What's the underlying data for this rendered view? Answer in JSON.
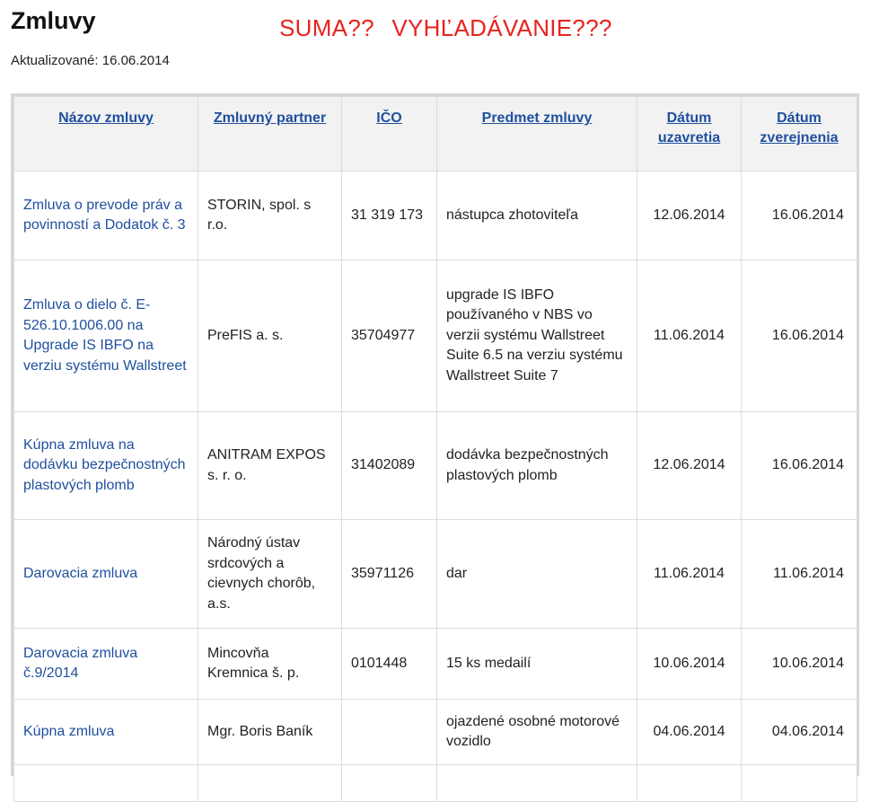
{
  "page": {
    "title": "Zmluvy",
    "annotation": "SUMA??   VYHĽADÁVANIE???",
    "updated": "Aktualizované: 16.06.2014"
  },
  "table": {
    "headers": [
      "Názov zmluvy",
      "Zmluvný partner",
      "IČO",
      "Predmet zmluvy",
      "Dátum uzavretia",
      "Dátum zverejnenia"
    ],
    "rows": [
      {
        "name": "Zmluva o prevode práv a povinností a Dodatok č. 3",
        "partner": "STORIN, spol. s r.o.",
        "ico": "31 319 173",
        "subject": "nástupca zhotoviteľa",
        "concluded": "12.06.2014",
        "published": "16.06.2014"
      },
      {
        "name": "Zmluva o dielo č. E-526.10.1006.00 na Upgrade IS IBFO na verziu systému Wallstreet",
        "partner": "PreFIS a. s.",
        "ico": "35704977",
        "subject": "upgrade IS IBFO používaného v NBS vo verzii systému Wallstreet Suite 6.5 na verziu systému Wallstreet Suite 7",
        "concluded": "11.06.2014",
        "published": "16.06.2014"
      },
      {
        "name": "Kúpna zmluva na dodávku bezpečnostných plastových plomb",
        "partner": "ANITRAM EXPOS s. r. o.",
        "ico": "31402089",
        "subject": "dodávka bezpečnostných plastových plomb",
        "concluded": "12.06.2014",
        "published": "16.06.2014"
      },
      {
        "name": "Darovacia zmluva",
        "partner": "Národný ústav srdcových a cievnych chorôb, a.s.",
        "ico": "35971126",
        "subject": "dar",
        "concluded": "11.06.2014",
        "published": "11.06.2014"
      },
      {
        "name": "Darovacia zmluva č.9/2014",
        "partner": "Mincovňa Kremnica š. p.",
        "ico": "0101448",
        "subject": "15 ks medailí",
        "concluded": "10.06.2014",
        "published": "10.06.2014"
      },
      {
        "name": "Kúpna zmluva",
        "partner": "Mgr. Boris Baník",
        "ico": "",
        "subject": "ojazdené osobné motorové vozidlo",
        "concluded": "04.06.2014",
        "published": "04.06.2014"
      }
    ]
  },
  "colors": {
    "link": "#1f4f9e",
    "annotation": "#e8231e",
    "header_bg": "#f2f2f2",
    "border": "#dcdcdc"
  }
}
